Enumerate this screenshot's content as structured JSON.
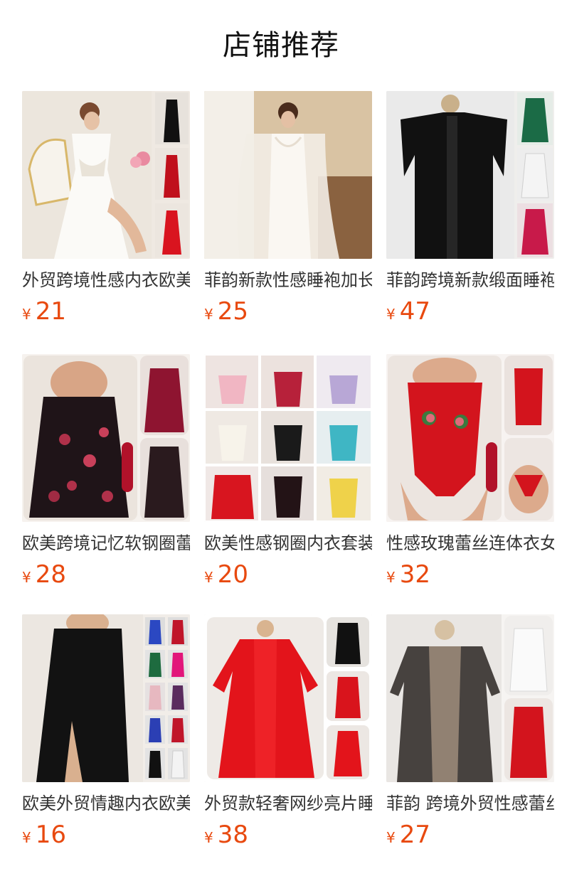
{
  "page": {
    "title": "店铺推荐"
  },
  "products": [
    {
      "name": "外贸跨境性感内衣欧美",
      "currency": "¥",
      "price": "21",
      "image_icon": "white-nightgown-product-photo"
    },
    {
      "name": "菲韵新款性感睡袍加长",
      "currency": "¥",
      "price": "25",
      "image_icon": "white-satin-robe-product-photo"
    },
    {
      "name": "菲韵跨境新款缎面睡袍",
      "currency": "¥",
      "price": "47",
      "image_icon": "black-satin-robe-product-photo"
    },
    {
      "name": "欧美跨境记忆软钢圈蕾",
      "currency": "¥",
      "price": "28",
      "image_icon": "floral-slip-dress-product-photo"
    },
    {
      "name": "欧美性感钢圈内衣套装",
      "currency": "¥",
      "price": "20",
      "image_icon": "lingerie-set-collage-product-photo"
    },
    {
      "name": "性感玫瑰蕾丝连体衣女",
      "currency": "¥",
      "price": "32",
      "image_icon": "red-lace-bodysuit-product-photo"
    },
    {
      "name": "欧美外贸情趣内衣欧美",
      "currency": "¥",
      "price": "16",
      "image_icon": "black-wrap-dress-product-photo"
    },
    {
      "name": "外贸款轻奢网纱亮片睡",
      "currency": "¥",
      "price": "38",
      "image_icon": "red-mesh-robe-product-photo"
    },
    {
      "name": "菲韵 跨境外贸性感蕾丝",
      "currency": "¥",
      "price": "27",
      "image_icon": "black-lace-robe-product-photo"
    }
  ],
  "colors": {
    "price": "#e8490f",
    "title": "#111111",
    "name": "#333333"
  }
}
